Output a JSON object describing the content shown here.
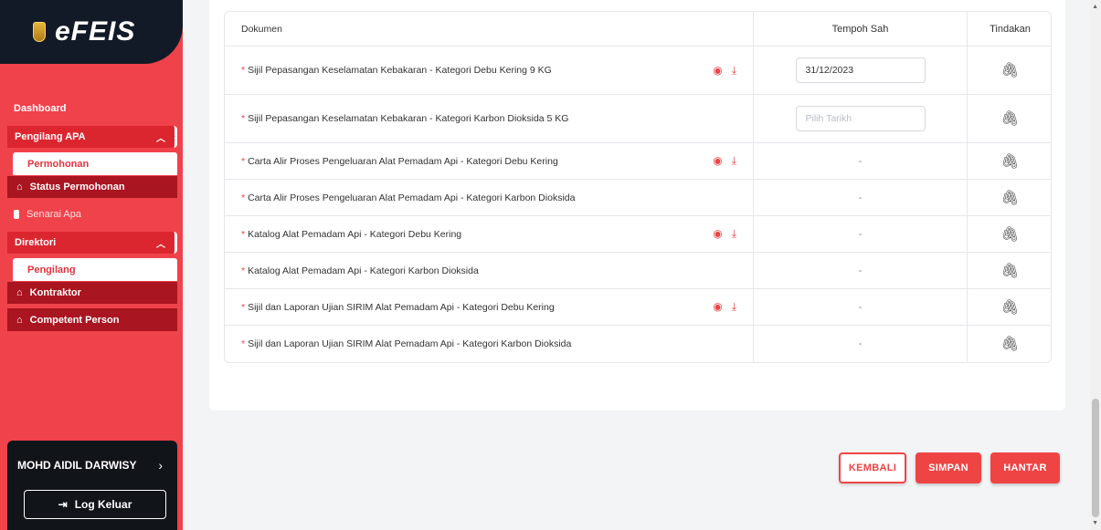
{
  "brand": {
    "name": "eFEIS"
  },
  "sidebar": {
    "dashboard": "Dashboard",
    "group1": {
      "label": "Pengilang APA",
      "active": "Permohonan",
      "items": [
        {
          "label": "Status Permohonan"
        }
      ],
      "extra": "Senarai Apa"
    },
    "group2": {
      "label": "Direktori",
      "active": "Pengilang",
      "items": [
        {
          "label": "Kontraktor"
        },
        {
          "label": "Competent Person"
        }
      ]
    },
    "user": {
      "name": "MOHD AIDIL DARWISY",
      "logout": "Log Keluar"
    }
  },
  "table": {
    "headers": {
      "doc": "Dokumen",
      "valid": "Tempoh Sah",
      "action": "Tindakan"
    },
    "rows": [
      {
        "name": "Sijil Pepasangan Keselamatan Kebakaran - Kategori Debu Kering 9 KG",
        "valid": "31/12/2023"
      },
      {
        "name": "Sijil Pepasangan Keselamatan Kebakaran - Kategori Karbon Dioksida 5 KG",
        "placeholder": "Pilih Tarikh"
      },
      {
        "name": "Carta Alir Proses Pengeluaran Alat Pemadam Api - Kategori Debu Kering",
        "valid": "-"
      },
      {
        "name": "Carta Alir Proses Pengeluaran Alat Pemadam Api - Kategori Karbon Dioksida",
        "valid": "-"
      },
      {
        "name": "Katalog Alat Pemadam Api - Kategori Debu Kering",
        "valid": "-"
      },
      {
        "name": "Katalog Alat Pemadam Api - Kategori Karbon Dioksida",
        "valid": "-"
      },
      {
        "name": "Sijil dan Laporan Ujian SIRIM Alat Pemadam Api - Kategori Debu Kering",
        "valid": "-"
      },
      {
        "name": "Sijil dan Laporan Ujian SIRIM Alat Pemadam Api - Kategori Karbon Dioksida",
        "valid": "-"
      }
    ],
    "required_mark": "*"
  },
  "buttons": {
    "back": "KEMBALI",
    "save": "SIMPAN",
    "submit": "HANTAR"
  },
  "icons": {
    "view": "eye-icon",
    "download": "download-icon",
    "attach": "paperclip-icon",
    "home": "home-icon",
    "logout": "logout-icon"
  },
  "colors": {
    "accent": "#ef4444",
    "sidebar": "#f0424a",
    "dark": "#131a27"
  }
}
